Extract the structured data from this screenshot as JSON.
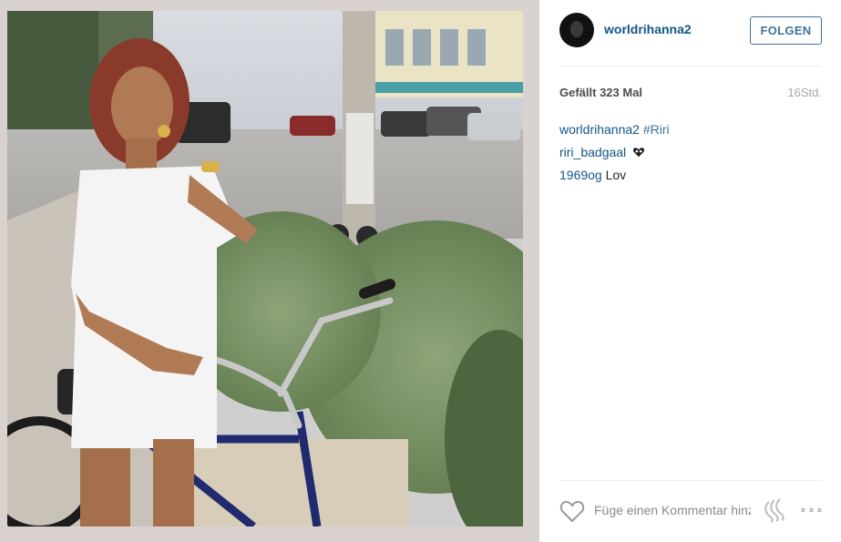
{
  "post": {
    "image_alt": ""
  },
  "header": {
    "username": "worldrihanna2",
    "follow_label": "FOLGEN"
  },
  "meta": {
    "likes": "Gefällt 323 Mal",
    "timestamp": "16Std."
  },
  "comments": [
    {
      "author": "worldrihanna2",
      "text": "",
      "hashtag": "#Riri"
    },
    {
      "author": "riri_badgaal",
      "text": "",
      "emoji": "heart-eyes-emoji"
    },
    {
      "author": "1969og",
      "text": "Lov"
    }
  ],
  "footer": {
    "comment_placeholder": "Füge einen Kommentar hinzu ...",
    "more_label": "∘∘∘"
  },
  "colors": {
    "link": "#125688",
    "hashtag": "#3f729b",
    "follow_border": "#3f729b",
    "muted": "#a5a7aa"
  },
  "icons": [
    "heart-icon",
    "instagram-logo-icon",
    "more-options-icon"
  ]
}
